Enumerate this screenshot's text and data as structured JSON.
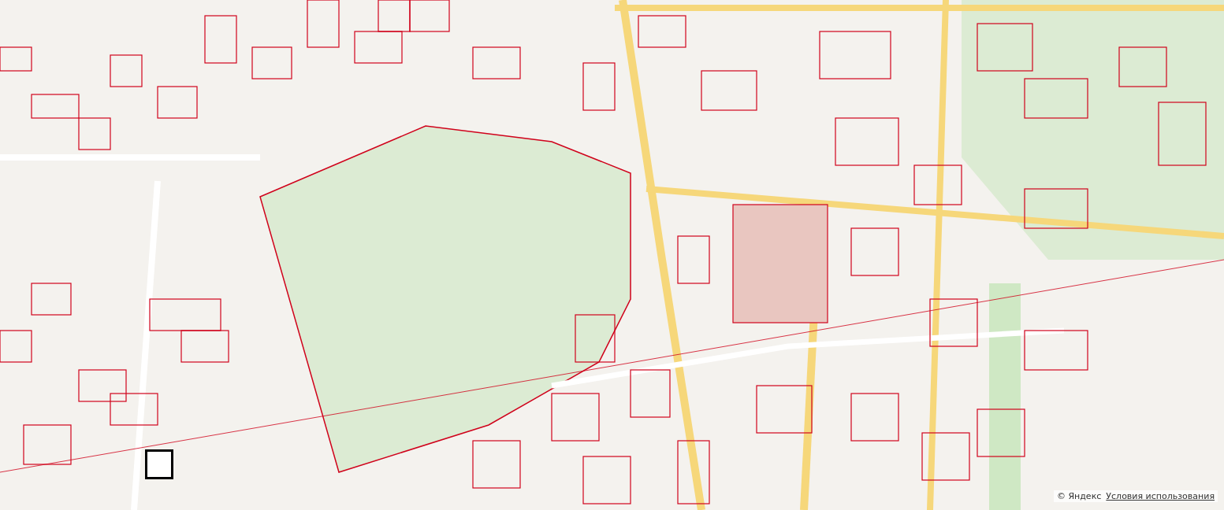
{
  "map": {
    "attribution": {
      "copyright": "© Яндекс",
      "terms_link": "Условия использования"
    },
    "selected_parcel": {
      "selected": true
    }
  }
}
